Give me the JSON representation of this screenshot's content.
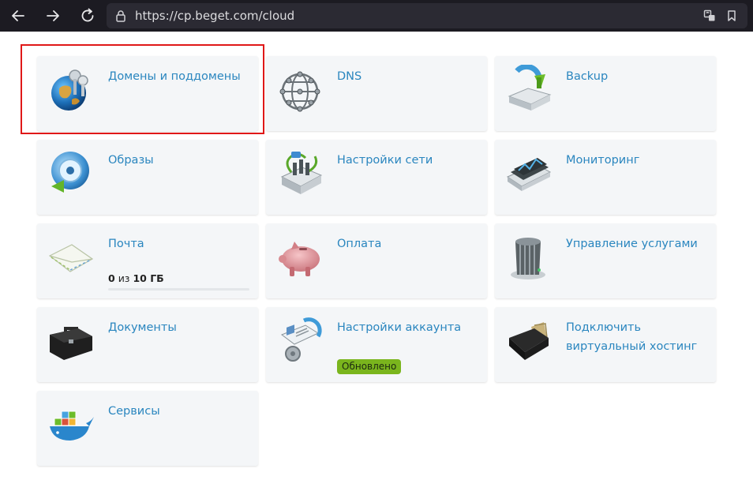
{
  "browser": {
    "url": "https://cp.beget.com/cloud",
    "back_icon": "arrow-left-icon",
    "forward_icon": "arrow-right-icon",
    "reload_icon": "reload-icon"
  },
  "tiles": {
    "domains": {
      "label": "Домены и поддомены",
      "icon": "globe-keys-icon"
    },
    "dns": {
      "label": "DNS",
      "icon": "network-sphere-icon"
    },
    "backup": {
      "label": "Backup",
      "icon": "backup-drive-icon"
    },
    "images": {
      "label": "Образы",
      "icon": "disc-icon"
    },
    "network": {
      "label": "Настройки сети",
      "icon": "network-switch-icon"
    },
    "monitoring": {
      "label": "Мониторинг",
      "icon": "monitoring-icon"
    },
    "mail": {
      "label": "Почта",
      "icon": "envelope-icon",
      "usage_used": "0",
      "usage_sep": "из",
      "usage_total": "10 ГБ",
      "usage_fraction": 0
    },
    "payment": {
      "label": "Оплата",
      "icon": "piggy-bank-icon"
    },
    "services_mgmt": {
      "label": "Управление услугами",
      "icon": "server-tower-icon"
    },
    "documents": {
      "label": "Документы",
      "icon": "briefcase-icon"
    },
    "account": {
      "label": "Настройки аккаунта",
      "icon": "account-settings-icon",
      "badge": "Обновлено"
    },
    "virtual_hosting": {
      "label": "Подключить виртуальный хостинг",
      "icon": "wallet-icon"
    },
    "services": {
      "label": "Сервисы",
      "icon": "whale-containers-icon"
    }
  },
  "colors": {
    "link": "#2a86bf",
    "tile_bg": "#f4f6f8",
    "badge": "#7ab51d",
    "highlight": "#e01818"
  }
}
